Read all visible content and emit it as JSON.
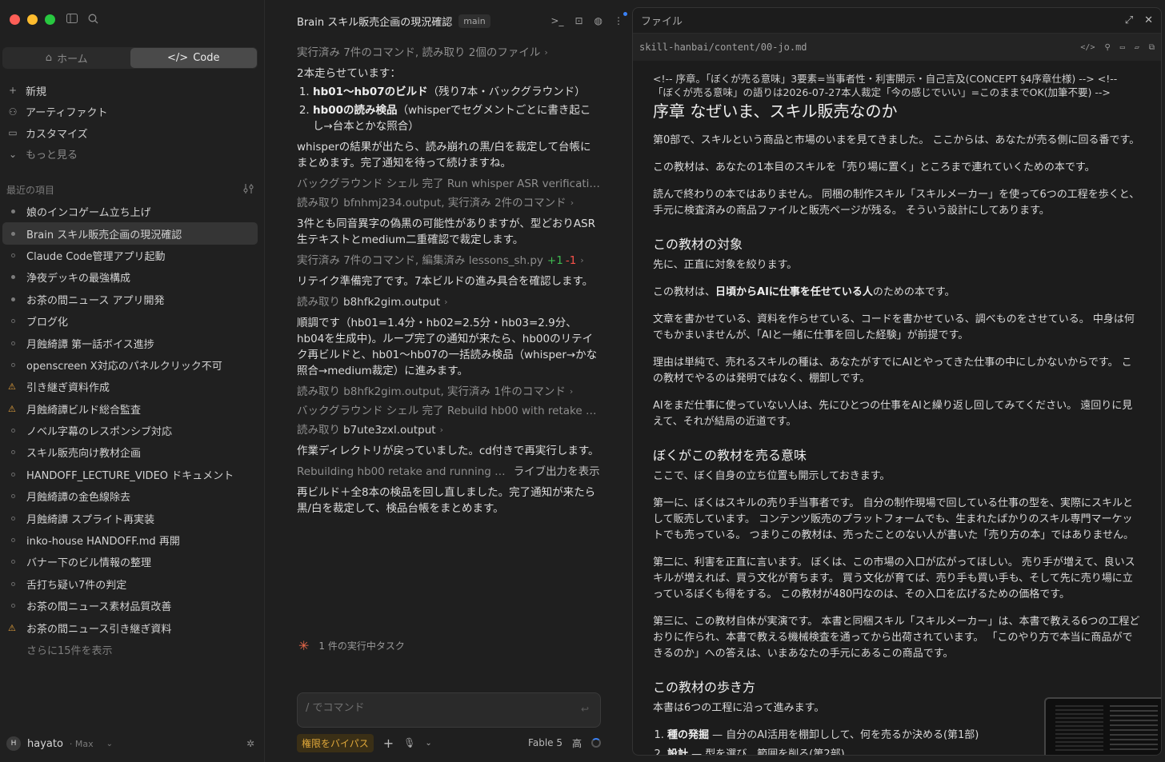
{
  "sidebar": {
    "mode_home": "ホーム",
    "mode_code": "Code",
    "nav": [
      {
        "icon": "plus-icon",
        "glyph": "+",
        "label": "新規"
      },
      {
        "icon": "artifact-icon",
        "glyph": "⚇",
        "label": "アーティファクト"
      },
      {
        "icon": "briefcase-icon",
        "glyph": "▭",
        "label": "カスタマイズ"
      },
      {
        "icon": "chevron-down-icon",
        "glyph": "⌄",
        "label": "もっと見る"
      }
    ],
    "recent_title": "最近の項目",
    "recent": [
      {
        "label": "娘のインコゲーム立ち上げ",
        "marker": "filled"
      },
      {
        "label": "Brain スキル販売企画の現況確認",
        "marker": "filled",
        "active": true
      },
      {
        "label": "Claude Code管理アプリ起動",
        "marker": "hollow"
      },
      {
        "label": "浄夜デッキの最強構成",
        "marker": "filled"
      },
      {
        "label": "お茶の間ニュース アプリ開発",
        "marker": "filled"
      },
      {
        "label": "ブログ化",
        "marker": "hollow"
      },
      {
        "label": "月蝕綺譚 第一話ボイス進捗",
        "marker": "hollow"
      },
      {
        "label": "openscreen X対応のパネルクリック不可",
        "marker": "hollow"
      },
      {
        "label": "引き継ぎ資料作成",
        "marker": "warn"
      },
      {
        "label": "月蝕綺譚ビルド総合監査",
        "marker": "warn"
      },
      {
        "label": "ノベル字幕のレスポンシブ対応",
        "marker": "hollow"
      },
      {
        "label": "スキル販売向け教材企画",
        "marker": "hollow"
      },
      {
        "label": "HANDOFF_LECTURE_VIDEO ドキュメント",
        "marker": "hollow"
      },
      {
        "label": "月蝕綺譚の金色線除去",
        "marker": "hollow"
      },
      {
        "label": "月蝕綺譚 スプライト再実装",
        "marker": "hollow"
      },
      {
        "label": "inko-house HANDOFF.md 再開",
        "marker": "hollow"
      },
      {
        "label": "バナー下のビル情報の整理",
        "marker": "hollow"
      },
      {
        "label": "舌打ち疑い7件の判定",
        "marker": "hollow"
      },
      {
        "label": "お茶の間ニュース素材品質改善",
        "marker": "hollow"
      },
      {
        "label": "お茶の間ニュース引き継ぎ資料",
        "marker": "warn"
      }
    ],
    "show_more": "さらに15件を表示",
    "user_initial": "H",
    "user_name": "hayato",
    "user_plan": "· Max"
  },
  "chat": {
    "title": "Brain スキル販売企画の現況確認",
    "branch": "main",
    "t1": "実行済み 7件のコマンド, 読み取り 2個のファイル",
    "m1": "2本走らせています：",
    "m1_li1_b": "hb01〜hb07のビルド",
    "m1_li1": "（残り7本・バックグラウンド）",
    "m1_li2_b": "hb00の読み検品",
    "m1_li2": "（whisperでセグメントごとに書き起こし→台本とかな照合）",
    "m2": "whisperの結果が出たら、読み崩れの黒/白を裁定して台帳にまとめます。完了通知を待って続けますね。",
    "t2": "バックグラウンド シェル 完了 Run whisper ASR verificati…",
    "t3": "読み取り bfnhmj234.output, 実行済み 2件のコマンド",
    "m3": "3件とも同音異字の偽黒の可能性がありますが、型どおりASR生テキストとmedium二重確認で裁定します。",
    "t4": "実行済み 7件のコマンド, 編集済み lessons_sh.py",
    "t4_plus": "+1",
    "t4_minus": "-1",
    "m4": "リテイク準備完了です。7本ビルドの進み具合を確認します。",
    "t5_prefix": "読み取り",
    "t5_file": "b8hfk2gim.output",
    "m5": "順調です（hb01=1.4分・hb02=2.5分・hb03=2.9分、hb04を生成中)。ループ完了の通知が来たら、hb00のリテイク再ビルドと、hb01〜hb07の一括読み検品（whisper→かな照合→medium裁定）に進みます。",
    "t6": "読み取り b8hfk2gim.output, 実行済み 1件のコマンド",
    "t7": "バックグラウンド シェル 完了 Rebuild hb00 with retake …",
    "t8_prefix": "読み取り",
    "t8_file": "b7ute3zxl.output",
    "m6": "作業ディレクトリが戻っていました。cd付きで再実行します。",
    "t9": "Rebuilding hb00 retake and running …",
    "t9_live": "ライブ出力を表示",
    "m7": "再ビルド＋全8本の検品を回し直しました。完了通知が来たら黒/白を裁定して、検品台帳をまとめます。",
    "running": "1 件の実行中タスク",
    "composer_placeholder": "/ でコマンド",
    "bypass": "権限をバイパス",
    "model": "Fable 5",
    "effort": "高"
  },
  "file": {
    "title": "ファイル",
    "path": "skill-hanbai/content/00-jo.md",
    "comment": "<!-- 序章。「ぼくが売る意味」3要素=当事者性・利害開示・自己言及(CONCEPT §4序章仕様) --> <!-- 「ぼくが売る意味」の語りは2026-07-27本人裁定「今の感じでいい」=このままでOK(加筆不要) -->",
    "h1": "序章 なぜいま、スキル販売なのか",
    "p1": "第0部で、スキルという商品と市場のいまを見てきました。 ここからは、あなたが売る側に回る番です。",
    "p2": "この教材は、あなたの1本目のスキルを「売り場に置く」ところまで連れていくための本です。",
    "p3": "読んで終わりの本ではありません。 同梱の制作スキル「スキルメーカー」を使って6つの工程を歩くと、手元に検査済みの商品ファイルと販売ページが残る。 そういう設計にしてあります。",
    "h2a": "この教材の対象",
    "p4": "先に、正直に対象を絞ります。",
    "p5_pre": "この教材は、",
    "p5_b": "日頃からAIに仕事を任せている人",
    "p5_post": "のための本です。",
    "p6": "文章を書かせている、資料を作らせている、コードを書かせている、調べものをさせている。 中身は何でもかまいませんが、「AIと一緒に仕事を回した経験」が前提です。",
    "p7": "理由は単純で、売れるスキルの種は、あなたがすでにAIとやってきた仕事の中にしかないからです。 この教材でやるのは発明ではなく、棚卸しです。",
    "p8": "AIをまだ仕事に使っていない人は、先にひとつの仕事をAIと繰り返し回してみてください。 遠回りに見えて、それが結局の近道です。",
    "h2b": "ぼくがこの教材を売る意味",
    "p9": "ここで、ぼく自身の立ち位置も開示しておきます。",
    "p10": "第一に、ぼくはスキルの売り手当事者です。 自分の制作現場で回している仕事の型を、実際にスキルとして販売しています。 コンテンツ販売のプラットフォームでも、生まれたばかりのスキル専門マーケットでも売っている。 つまりこの教材は、売ったことのない人が書いた「売り方の本」ではありません。",
    "p11": "第二に、利害を正直に言います。 ぼくは、この市場の入口が広がってほしい。 売り手が増えて、良いスキルが増えれば、買う文化が育ちます。 買う文化が育てば、売り手も買い手も、そして先に売り場に立っているぼくも得をする。 この教材が480円なのは、その入口を広げるための価格です。",
    "p12": "第三に、この教材自体が実演です。 本書と同梱スキル「スキルメーカー」は、本書で教える6つの工程どおりに作られ、本書で教える機械検査を通ってから出荷されています。 「このやり方で本当に商品ができるのか」への答えは、いまあなたの手元にあるこの商品です。",
    "h2c": "この教材の歩き方",
    "p13": "本書は6つの工程に沿って進みます。",
    "li1_b": "種の発掘",
    "li1": " — 自分のAI活用を棚卸しして、何を売るか決める(第1部)",
    "li2_b": "設計",
    "li2": " — 型を選び、範囲を削る(第2部)"
  }
}
